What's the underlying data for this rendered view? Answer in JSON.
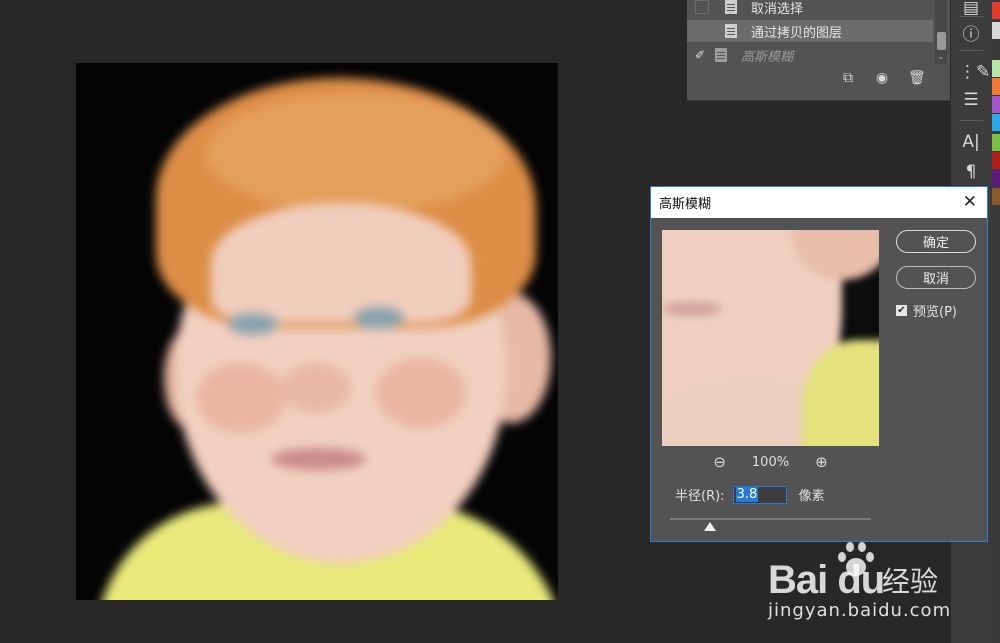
{
  "history": {
    "items": [
      {
        "label": "取消选择"
      },
      {
        "label": "通过拷贝的图层"
      },
      {
        "label": "高斯模糊"
      }
    ],
    "tools": [
      "new-snapshot-icon",
      "camera-icon",
      "trash-icon"
    ]
  },
  "right_toolbar": {
    "icons": [
      "layers-icon",
      "info-icon",
      "brush-settings-icon",
      "adjustments-icon",
      "character-icon",
      "paragraph-icon"
    ],
    "swatches": [
      "#e23b2e",
      "#d8d8d8",
      "#b9e6a8",
      "#f07a3a",
      "#ff5b9a",
      "#a055c8",
      "#2aa8e8",
      "#7bc043",
      "#b01e1e",
      "#5a1a7a",
      "#e8b22e"
    ]
  },
  "dialog": {
    "title": "高斯模糊",
    "ok_label": "确定",
    "cancel_label": "取消",
    "preview_label": "预览(P)",
    "preview_checked": true,
    "zoom_level": "100%",
    "radius_label": "半径(R):",
    "radius_value": "3.8",
    "radius_unit": "像素"
  },
  "watermark": {
    "logo_text": "Bai du",
    "cn_text": "经验",
    "url": "jingyan.baidu.com"
  }
}
